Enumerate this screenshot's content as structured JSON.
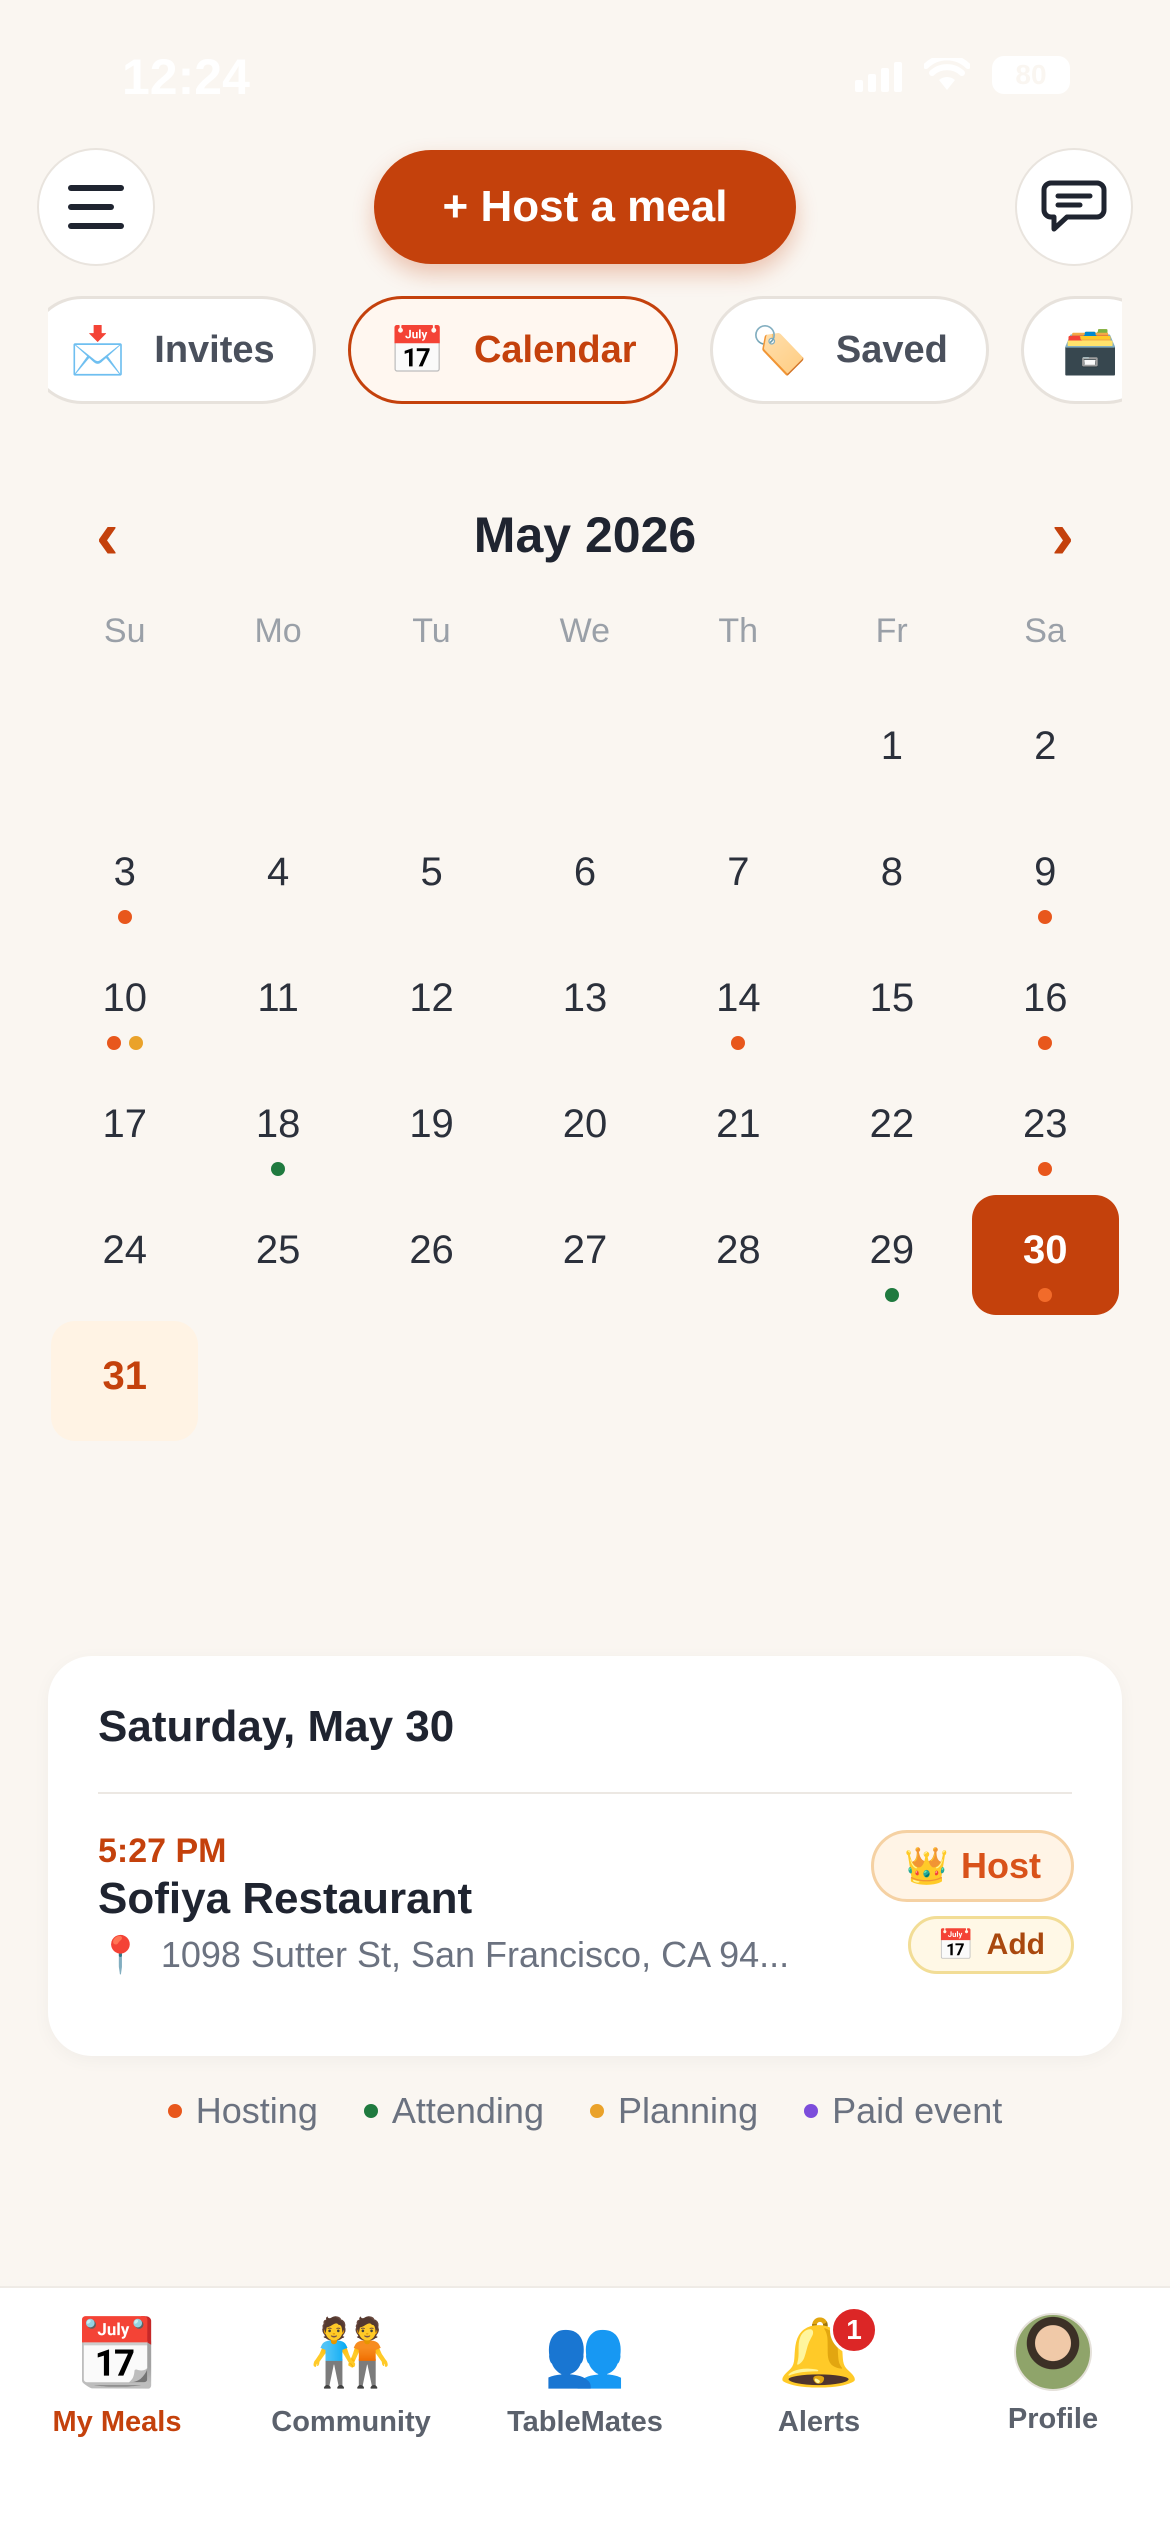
{
  "status_bar": {
    "time": "12:24",
    "battery": "80"
  },
  "header": {
    "host_button": "+ Host a meal"
  },
  "tabs": [
    {
      "label": "Invites",
      "icon": "envelope-icon",
      "emoji": "📩",
      "active": false
    },
    {
      "label": "Calendar",
      "icon": "calendar-icon",
      "emoji": "📅",
      "active": true
    },
    {
      "label": "Saved",
      "icon": "tag-icon",
      "emoji": "🏷️",
      "active": false
    },
    {
      "label": "",
      "icon": "box-icon",
      "emoji": "🗃️",
      "active": false
    }
  ],
  "calendar": {
    "month_label": "May 2026",
    "prev_arrow": "‹",
    "next_arrow": "›",
    "weekdays": [
      "Su",
      "Mo",
      "Tu",
      "We",
      "Th",
      "Fr",
      "Sa"
    ],
    "leading_blanks": 5,
    "days": [
      {
        "n": "1",
        "dots": []
      },
      {
        "n": "2",
        "dots": []
      },
      {
        "n": "3",
        "dots": [
          "hosting"
        ]
      },
      {
        "n": "4",
        "dots": []
      },
      {
        "n": "5",
        "dots": []
      },
      {
        "n": "6",
        "dots": []
      },
      {
        "n": "7",
        "dots": []
      },
      {
        "n": "8",
        "dots": []
      },
      {
        "n": "9",
        "dots": [
          "hosting"
        ]
      },
      {
        "n": "10",
        "dots": [
          "hosting",
          "planning"
        ]
      },
      {
        "n": "11",
        "dots": []
      },
      {
        "n": "12",
        "dots": []
      },
      {
        "n": "13",
        "dots": []
      },
      {
        "n": "14",
        "dots": [
          "hosting"
        ]
      },
      {
        "n": "15",
        "dots": []
      },
      {
        "n": "16",
        "dots": [
          "hosting"
        ]
      },
      {
        "n": "17",
        "dots": []
      },
      {
        "n": "18",
        "dots": [
          "attending"
        ]
      },
      {
        "n": "19",
        "dots": []
      },
      {
        "n": "20",
        "dots": []
      },
      {
        "n": "21",
        "dots": []
      },
      {
        "n": "22",
        "dots": []
      },
      {
        "n": "23",
        "dots": [
          "hosting"
        ]
      },
      {
        "n": "24",
        "dots": []
      },
      {
        "n": "25",
        "dots": []
      },
      {
        "n": "26",
        "dots": []
      },
      {
        "n": "27",
        "dots": []
      },
      {
        "n": "28",
        "dots": []
      },
      {
        "n": "29",
        "dots": [
          "attending"
        ]
      },
      {
        "n": "30",
        "dots": [
          "hosting"
        ],
        "selected": true
      },
      {
        "n": "31",
        "dots": [],
        "today": true
      }
    ]
  },
  "event_card": {
    "date_label": "Saturday, May 30",
    "time": "5:27 PM",
    "name": "Sofiya Restaurant",
    "address": "1098 Sutter St, San Francisco, CA 94...",
    "host_badge": "Host",
    "add_badge": "Add"
  },
  "legend": [
    {
      "key": "hosting",
      "label": "Hosting"
    },
    {
      "key": "attending",
      "label": "Attending"
    },
    {
      "key": "planning",
      "label": "Planning"
    },
    {
      "key": "paid",
      "label": "Paid event"
    }
  ],
  "colors": {
    "accent": "#c4410c",
    "hosting": "#e8571c",
    "attending": "#1f7a3f",
    "planning": "#eaa22a",
    "paid": "#7c4ddb"
  },
  "bottom_nav": [
    {
      "label": "My Meals",
      "icon": "calendar-icon",
      "emoji": "📆",
      "active": true
    },
    {
      "label": "Community",
      "icon": "people-icon",
      "emoji": "🧑‍🤝‍🧑",
      "active": false
    },
    {
      "label": "TableMates",
      "icon": "group-icon",
      "emoji": "👥",
      "active": false
    },
    {
      "label": "Alerts",
      "icon": "bell-icon",
      "emoji": "🔔",
      "active": false,
      "badge": "1"
    },
    {
      "label": "Profile",
      "icon": "avatar",
      "emoji": "",
      "active": false
    }
  ]
}
